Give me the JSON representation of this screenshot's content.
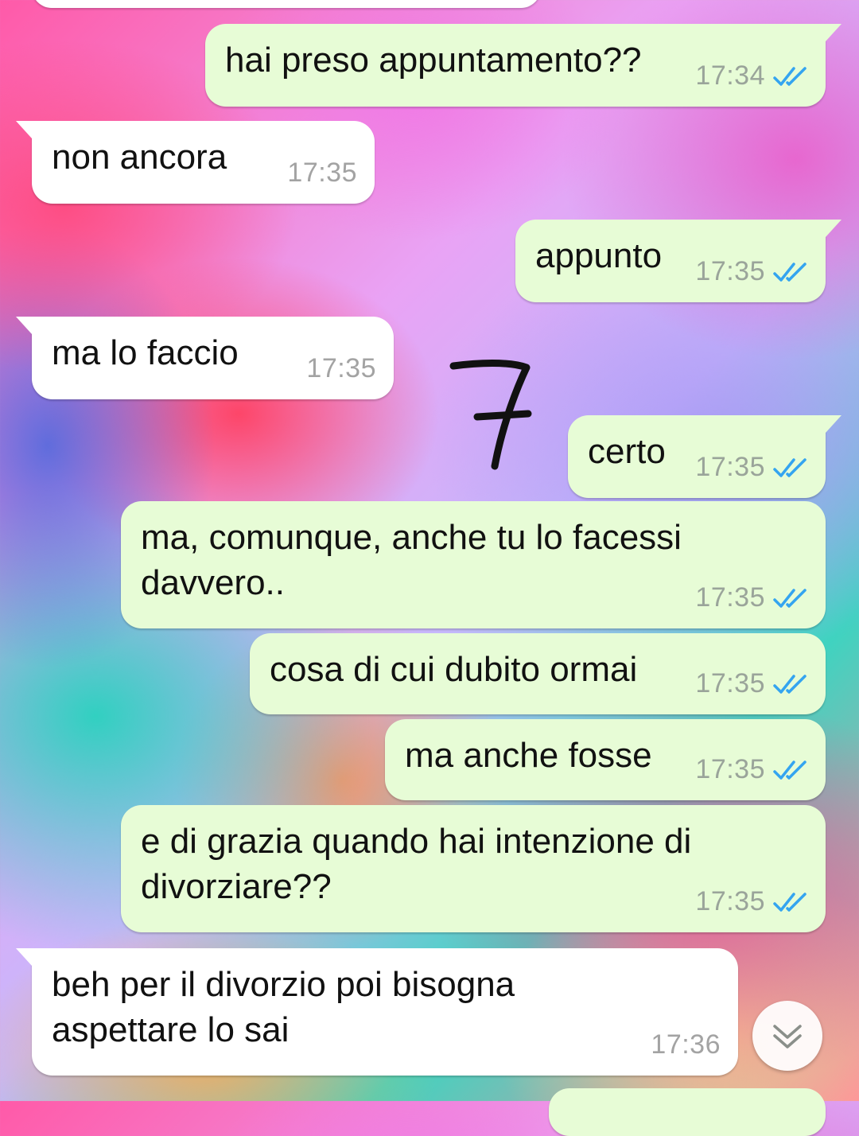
{
  "messages": [
    {
      "text": "hai preso appuntamento??",
      "time": "17:34"
    },
    {
      "text": "non ancora",
      "time": "17:35"
    },
    {
      "text": "appunto",
      "time": "17:35"
    },
    {
      "text": "ma lo faccio",
      "time": "17:35"
    },
    {
      "text": "certo",
      "time": "17:35"
    },
    {
      "text": "ma, comunque, anche tu lo facessi\ndavvero..",
      "time": "17:35"
    },
    {
      "text": "cosa di cui dubito ormai",
      "time": "17:35"
    },
    {
      "text": "ma anche fosse",
      "time": "17:35"
    },
    {
      "text": "e di grazia quando hai intenzione di\ndivorziare??",
      "time": "17:35"
    },
    {
      "text": "beh per il divorzio poi bisogna\naspettare lo sai",
      "time": "17:36"
    }
  ],
  "annotation": "7",
  "colors": {
    "outgoing_bubble": "#e7fcd6",
    "incoming_bubble": "#ffffff",
    "read_ticks": "#34a4f0",
    "timestamp": "#9aa49a"
  },
  "icons": {
    "read_receipt": "double-check-icon",
    "scroll_down": "chevron-double-down-icon"
  }
}
